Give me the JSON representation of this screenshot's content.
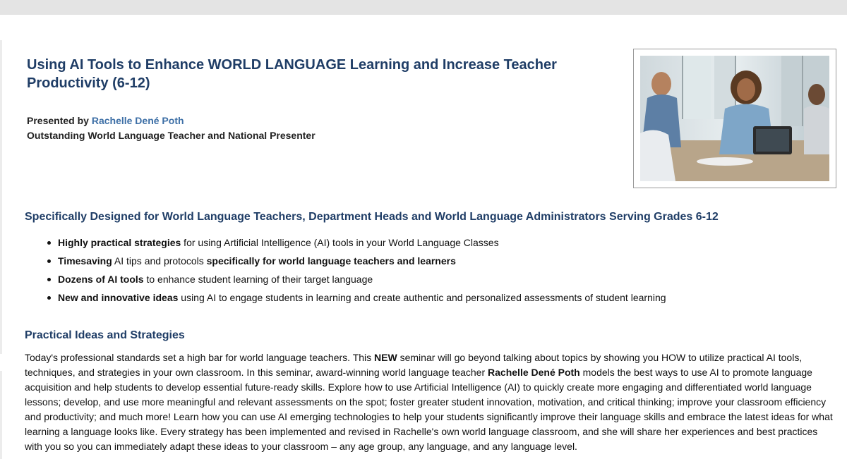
{
  "title": "Using AI Tools to Enhance WORLD LANGUAGE Learning and Increase Teacher Productivity (6-12)",
  "presenter": {
    "prefix": "Presented by ",
    "name": "Rachelle Dené Poth",
    "role": "Outstanding World Language Teacher and National Presenter"
  },
  "section1_heading": "Specifically Designed for World Language Teachers, Department Heads and World Language Administrators Serving Grades 6-12",
  "bullets": [
    {
      "bold": "Highly practical strategies",
      "text": " for using Artificial Intelligence (AI) tools in your World Language Classes",
      "bold2": "",
      "text2": ""
    },
    {
      "bold": "Timesaving",
      "text": " AI tips and protocols ",
      "bold2": "specifically for world language teachers and learners",
      "text2": ""
    },
    {
      "bold": "Dozens of AI tools",
      "text": " to enhance student learning of their target language",
      "bold2": "",
      "text2": ""
    },
    {
      "bold": "New and innovative ideas",
      "text": " using AI to engage students in learning and create authentic and personalized assessments of student learning",
      "bold2": "",
      "text2": ""
    }
  ],
  "section2_heading": "Practical Ideas and Strategies",
  "paragraph": {
    "p1": "Today's professional standards set a high bar for world language teachers. This ",
    "b1": "NEW",
    "p2": " seminar will go beyond talking about topics by showing you HOW to utilize practical AI tools, techniques, and strategies in your own classroom. In this seminar, award-winning world language teacher ",
    "b2": "Rachelle Dené Poth",
    "p3": " models the best ways to use AI to promote language acquisition and help students to develop essential future-ready skills. Explore how to use Artificial Intelligence (AI) to quickly create more engaging and differentiated world language lessons; develop, and use more meaningful and relevant assessments on the spot; foster greater student innovation, motivation, and critical thinking; improve your classroom efficiency and productivity; and much more! Learn how you can use AI emerging technologies to help your students significantly improve their language skills and embrace the latest ideas for what learning a language looks like. Every strategy has been implemented and revised in Rachelle's own world language classroom, and she will share her experiences and best practices with you so you can immediately adapt these ideas to your classroom – any age group, any language, and any language level."
  }
}
